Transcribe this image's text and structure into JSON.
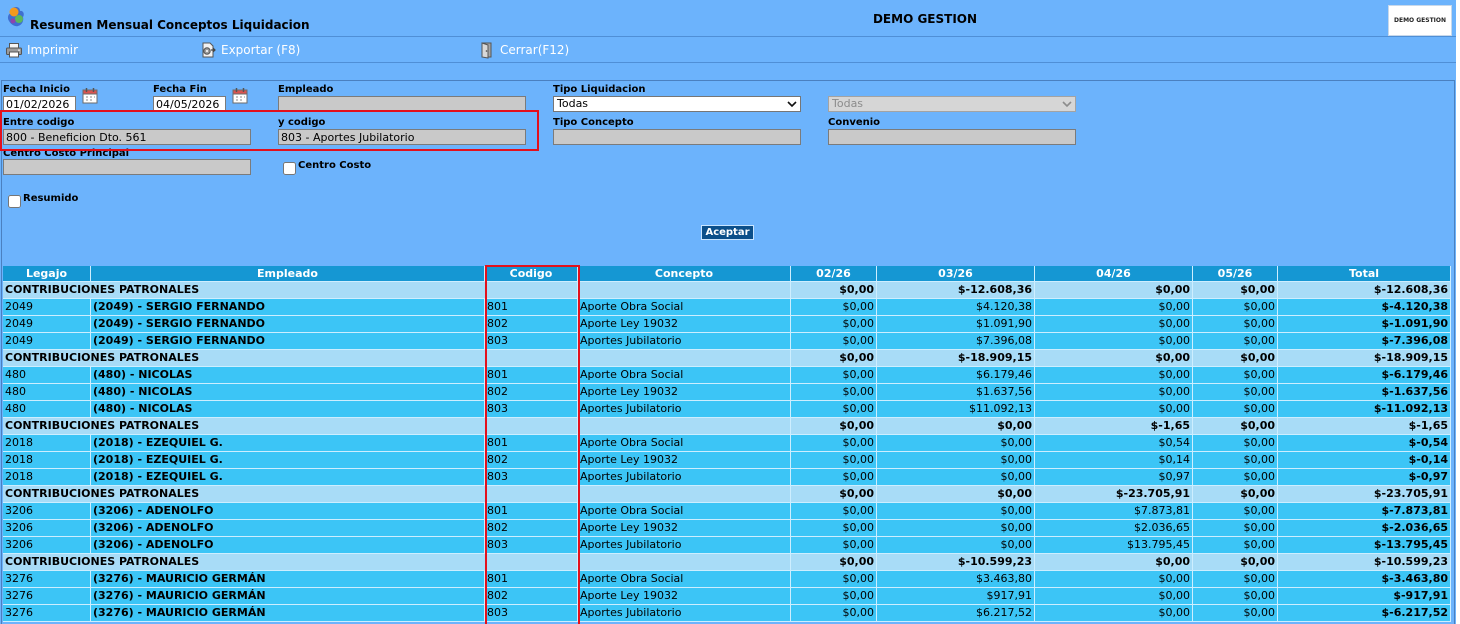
{
  "window": {
    "title": "Resumen Mensual Conceptos Liquidacion",
    "company": "DEMO GESTION",
    "logo_text": "DEMO GESTION"
  },
  "toolbar": {
    "print_label": "Imprimir",
    "export_label": "Exportar (F8)",
    "close_label": "Cerrar(F12)"
  },
  "icons": {
    "app": "app-icon",
    "print": "printer-icon",
    "export": "export-icon",
    "close": "exit-door-icon",
    "date_picker": "calendar-icon",
    "dropdown": "chevron-down-icon"
  },
  "filters": {
    "fecha_inicio": {
      "label": "Fecha Inicio",
      "value": "01/02/2026"
    },
    "fecha_fin": {
      "label": "Fecha Fin",
      "value": "04/05/2026"
    },
    "empleado": {
      "label": "Empleado"
    },
    "tipo_liquidacion": {
      "label": "Tipo Liquidacion",
      "value": "Todas"
    },
    "sub_liquidacion": {
      "value": "Todas"
    },
    "entre_codigo": {
      "label": "Entre codigo",
      "value": "800 - Beneficion Dto. 561"
    },
    "y_codigo": {
      "label": "y codigo",
      "value": "803 - Aportes Jubilatorio"
    },
    "tipo_concepto": {
      "label": "Tipo Concepto"
    },
    "convenio": {
      "label": "Convenio"
    },
    "centro_costo_principal": {
      "label": "Centro Costo Principal"
    },
    "centro_costo": {
      "label": "Centro Costo",
      "checked": false
    },
    "resumido": {
      "label": "Resumido",
      "checked": false
    },
    "accept_label": "Aceptar"
  },
  "table": {
    "columns": [
      "Legajo",
      "Empleado",
      "Codigo",
      "Concepto",
      "02/26",
      "03/26",
      "04/26",
      "05/26",
      "Total"
    ],
    "groups": [
      {
        "label": "CONTRIBUCIONES PATRONALES",
        "values": [
          "$0,00",
          "$-12.608,36",
          "$0,00",
          "$0,00"
        ],
        "total": "$-12.608,36",
        "items": [
          {
            "legajo": "2049",
            "empleado": "(2049) - SERGIO FERNANDO",
            "codigo": "801",
            "concepto": "Aporte Obra Social",
            "values": [
              "$0,00",
              "$4.120,38",
              "$0,00",
              "$0,00"
            ],
            "total": "$-4.120,38"
          },
          {
            "legajo": "2049",
            "empleado": "(2049) - SERGIO FERNANDO",
            "codigo": "802",
            "concepto": "Aporte Ley 19032",
            "values": [
              "$0,00",
              "$1.091,90",
              "$0,00",
              "$0,00"
            ],
            "total": "$-1.091,90"
          },
          {
            "legajo": "2049",
            "empleado": "(2049) - SERGIO FERNANDO",
            "codigo": "803",
            "concepto": "Aportes Jubilatorio",
            "values": [
              "$0,00",
              "$7.396,08",
              "$0,00",
              "$0,00"
            ],
            "total": "$-7.396,08"
          }
        ]
      },
      {
        "label": "CONTRIBUCIONES PATRONALES",
        "values": [
          "$0,00",
          "$-18.909,15",
          "$0,00",
          "$0,00"
        ],
        "total": "$-18.909,15",
        "items": [
          {
            "legajo": "480",
            "empleado": "(480) - NICOLAS",
            "codigo": "801",
            "concepto": "Aporte Obra Social",
            "values": [
              "$0,00",
              "$6.179,46",
              "$0,00",
              "$0,00"
            ],
            "total": "$-6.179,46"
          },
          {
            "legajo": "480",
            "empleado": "(480) - NICOLAS",
            "codigo": "802",
            "concepto": "Aporte Ley 19032",
            "values": [
              "$0,00",
              "$1.637,56",
              "$0,00",
              "$0,00"
            ],
            "total": "$-1.637,56"
          },
          {
            "legajo": "480",
            "empleado": "(480) - NICOLAS",
            "codigo": "803",
            "concepto": "Aportes Jubilatorio",
            "values": [
              "$0,00",
              "$11.092,13",
              "$0,00",
              "$0,00"
            ],
            "total": "$-11.092,13"
          }
        ]
      },
      {
        "label": "CONTRIBUCIONES PATRONALES",
        "values": [
          "$0,00",
          "$0,00",
          "$-1,65",
          "$0,00"
        ],
        "total": "$-1,65",
        "items": [
          {
            "legajo": "2018",
            "empleado": "(2018) - EZEQUIEL G.",
            "codigo": "801",
            "concepto": "Aporte Obra Social",
            "values": [
              "$0,00",
              "$0,00",
              "$0,54",
              "$0,00"
            ],
            "total": "$-0,54"
          },
          {
            "legajo": "2018",
            "empleado": "(2018) - EZEQUIEL G.",
            "codigo": "802",
            "concepto": "Aporte Ley 19032",
            "values": [
              "$0,00",
              "$0,00",
              "$0,14",
              "$0,00"
            ],
            "total": "$-0,14"
          },
          {
            "legajo": "2018",
            "empleado": "(2018) - EZEQUIEL G.",
            "codigo": "803",
            "concepto": "Aportes Jubilatorio",
            "values": [
              "$0,00",
              "$0,00",
              "$0,97",
              "$0,00"
            ],
            "total": "$-0,97"
          }
        ]
      },
      {
        "label": "CONTRIBUCIONES PATRONALES",
        "values": [
          "$0,00",
          "$0,00",
          "$-23.705,91",
          "$0,00"
        ],
        "total": "$-23.705,91",
        "items": [
          {
            "legajo": "3206",
            "empleado": "(3206) - ADENOLFO",
            "codigo": "801",
            "concepto": "Aporte Obra Social",
            "values": [
              "$0,00",
              "$0,00",
              "$7.873,81",
              "$0,00"
            ],
            "total": "$-7.873,81"
          },
          {
            "legajo": "3206",
            "empleado": "(3206) - ADENOLFO",
            "codigo": "802",
            "concepto": "Aporte Ley 19032",
            "values": [
              "$0,00",
              "$0,00",
              "$2.036,65",
              "$0,00"
            ],
            "total": "$-2.036,65"
          },
          {
            "legajo": "3206",
            "empleado": "(3206) - ADENOLFO",
            "codigo": "803",
            "concepto": "Aportes Jubilatorio",
            "values": [
              "$0,00",
              "$0,00",
              "$13.795,45",
              "$0,00"
            ],
            "total": "$-13.795,45"
          }
        ]
      },
      {
        "label": "CONTRIBUCIONES PATRONALES",
        "values": [
          "$0,00",
          "$-10.599,23",
          "$0,00",
          "$0,00"
        ],
        "total": "$-10.599,23",
        "items": [
          {
            "legajo": "3276",
            "empleado": "(3276) - MAURICIO GERMÁN",
            "codigo": "801",
            "concepto": "Aporte Obra Social",
            "values": [
              "$0,00",
              "$3.463,80",
              "$0,00",
              "$0,00"
            ],
            "total": "$-3.463,80"
          },
          {
            "legajo": "3276",
            "empleado": "(3276) - MAURICIO GERMÁN",
            "codigo": "802",
            "concepto": "Aporte Ley 19032",
            "values": [
              "$0,00",
              "$917,91",
              "$0,00",
              "$0,00"
            ],
            "total": "$-917,91"
          },
          {
            "legajo": "3276",
            "empleado": "(3276) - MAURICIO GERMÁN",
            "codigo": "803",
            "concepto": "Aportes Jubilatorio",
            "values": [
              "$0,00",
              "$6.217,52",
              "$0,00",
              "$0,00"
            ],
            "total": "$-6.217,52"
          }
        ]
      }
    ]
  },
  "colors": {
    "background": "#6cb3fc",
    "table_header": "#1597d3",
    "data_row": "#3cc5f6",
    "group_row": "#a8dcf7",
    "button": "#0b4f8a",
    "highlight": "#e3101c"
  }
}
